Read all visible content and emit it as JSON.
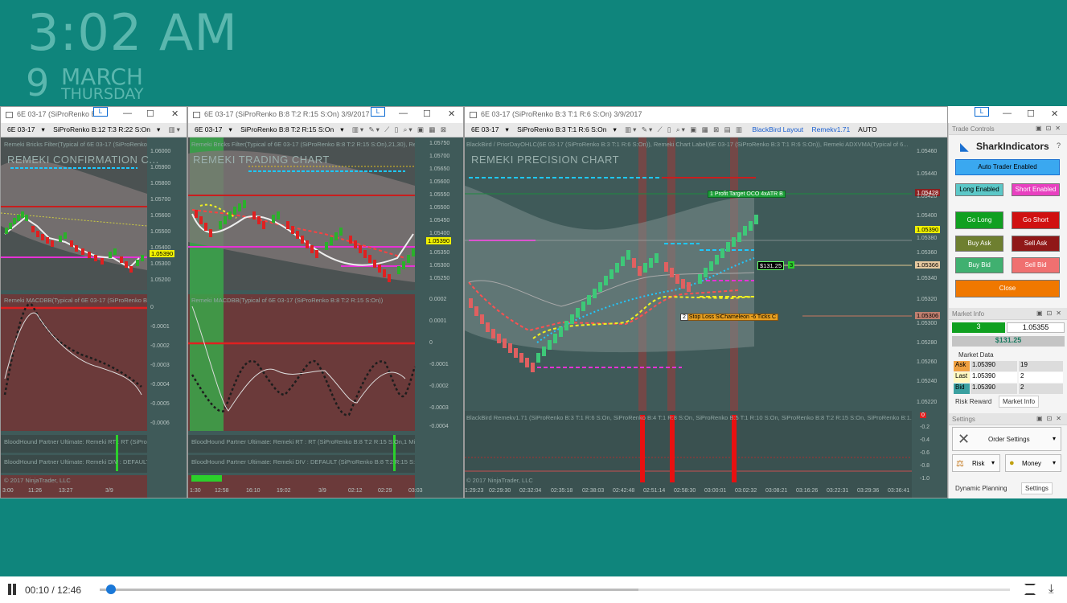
{
  "clock": {
    "time": "3:02 AM",
    "day": "9",
    "month": "MARCH",
    "weekday": "THURSDAY"
  },
  "windows": [
    {
      "title": "6E 03-17 (SiProRenko B:1...",
      "instrument": "6E 03-17",
      "period": "SiProRenko B:12 T:3 R:22 S:On",
      "chart_title": "REMEKI CONFIRMATION C...",
      "indicator_label": "Remeki Bricks Filter(Typical of 6E 03-17 (SiProRenko B:...",
      "osc_label": "Remeki MACDBB(Typical of 6E 03-17 (SiProRenko B:...",
      "hound1": "BloodHound Partner Ultimate: Remeki RT : RT (SiPro...",
      "hound2": "BloodHound Partner Ultimate: Remeki DIV : DEFAULT (...",
      "copyright": "© 2017 NinjaTrader, LLC",
      "price_tag": "1.05390",
      "y_ticks": [
        "1.06000",
        "1.05900",
        "1.05800",
        "1.05700",
        "1.05600",
        "1.05500",
        "1.05400",
        "1.05300",
        "1.05200"
      ],
      "osc_ticks": [
        "0",
        "-0.0001",
        "-0.0002",
        "-0.0003",
        "-0.0004",
        "-0.0005",
        "-0.0006"
      ],
      "x_ticks": [
        "3:00",
        "11:26",
        "13:27",
        "3/9"
      ]
    },
    {
      "title": "6E 03-17 (SiProRenko B:8 T:2 R:15 S:On) 3/9/2017",
      "instrument": "6E 03-17",
      "period": "SiProRenko B:8 T:2 R:15 S:On",
      "chart_title": "REMEKI TRADING CHART",
      "indicator_label": "Remeki Bricks Filter(Typical of 6E 03-17 (SiProRenko B:8 T:2 R:15 S:On),21,30), Remeki Ch...",
      "osc_label": "Remeki MACDBB(Typical of 6E 03-17 (SiProRenko B:8 T:2 R:15 S:On))",
      "hound1": "BloodHound Partner Ultimate: Remeki RT : RT (SiProRenko B:8 T:2 R:15 S:On,1 Min...",
      "hound2": "BloodHound Partner Ultimate: Remeki DIV : DEFAULT (SiProRenko B:8 T:2 R:15 S:On...",
      "copyright": "© 2017 NinjaTrader, LLC",
      "price_tag": "1.05390",
      "y_ticks": [
        "1.05750",
        "1.05700",
        "1.05650",
        "1.05600",
        "1.05550",
        "1.05500",
        "1.05450",
        "1.05400",
        "1.05350",
        "1.05300",
        "1.05250"
      ],
      "osc_ticks": [
        "0.0002",
        "0.0001",
        "0",
        "-0.0001",
        "-0.0002",
        "-0.0003",
        "-0.0004"
      ],
      "x_ticks": [
        "1:30",
        "12:58",
        "16:10",
        "19:02",
        "3/9",
        "02:12",
        "02:29",
        "03:03"
      ]
    },
    {
      "title": "6E 03-17 (SiProRenko B:3 T:1 R:6 S:On) 3/9/2017",
      "instrument": "6E 03-17",
      "period": "SiProRenko B:3 T:1 R:6 S:On",
      "layout": "BlackBird Layout",
      "version": "Remekv1.71",
      "auto": "AUTO",
      "chart_title": "REMEKI PRECISION CHART",
      "indicator_label": "BlackBird / PriorDayOHLC(6E 03-17 (SiProRenko B:3 T:1 R:6 S:On)), Remeki Chart Label(6E 03-17 (SiProRenko B:3 T:1 R:6 S:On)), Remeki ADXVMA(Typical of 6...",
      "osc_label": "BlackBird Remekv1.71 (SiProRenko B:3 T:1 R:6 S:On, SiProRenko B:4 T:1 R:8 S:On, SiProRenko B:5 T:1 R:10 S:On, SiProRenko B:8 T:2 R:15 S:On, SiProRenko B:1...",
      "copyright": "© 2017 NinjaTrader, LLC",
      "profit_target": "1  Profit Target OCO  4xATR B",
      "stop_loss": "1  Stop Loss SiChameleon -6 Ticks C",
      "stop_num": "2",
      "pnl": "$131.25",
      "pos_qty": "3",
      "price_top": "1.05428",
      "price_last": "1.05390",
      "price_entry": "1.05366",
      "price_stop": "1.05306",
      "y_ticks": [
        "1.05460",
        "1.05440",
        "1.05420",
        "1.05400",
        "1.05380",
        "1.05360",
        "1.05340",
        "1.05320",
        "1.05300",
        "1.05280",
        "1.05260",
        "1.05240",
        "1.05220"
      ],
      "osc_ticks": [
        "0",
        "-0.2",
        "-0.4",
        "-0.6",
        "-0.8",
        "-1.0"
      ],
      "x_ticks": [
        "1:29:23",
        "02:29:30",
        "02:32:04",
        "02:35:18",
        "02:38:03",
        "02:42:48",
        "02:51:14",
        "02:58:30",
        "03:00:01",
        "03:02:32",
        "03:08:21",
        "03:16:26",
        "03:22:31",
        "03:29:36",
        "03:36:41"
      ]
    }
  ],
  "trade_controls": {
    "header": "Trade Controls",
    "brand": "SharkIndicators",
    "auto_trader": "Auto Trader Enabled",
    "long_enabled": "Long Enabled",
    "short_enabled": "Short Enabled",
    "go_long": "Go Long",
    "go_short": "Go Short",
    "buy_ask": "Buy Ask",
    "sell_ask": "Sell Ask",
    "buy_bid": "Buy Bid",
    "sell_bid": "Sell Bid",
    "close": "Close"
  },
  "market_info": {
    "header": "Market Info",
    "position": "3",
    "last_price": "1.05355",
    "pnl": "$131.25",
    "market_data_label": "Market Data",
    "rows": [
      {
        "label": "Ask",
        "price": "1.05390",
        "size": "19"
      },
      {
        "label": "Last",
        "price": "1.05390",
        "size": "2"
      },
      {
        "label": "Bid",
        "price": "1.05390",
        "size": "2"
      }
    ],
    "tab_risk": "Risk Reward",
    "tab_market": "Market Info"
  },
  "settings": {
    "header": "Settings",
    "order_settings": "Order Settings",
    "risk": "Risk",
    "money": "Money",
    "tab_dynamic": "Dynamic Planning",
    "tab_settings": "Settings"
  },
  "player": {
    "time": "00:10 / 12:46",
    "progress": 0.013
  }
}
